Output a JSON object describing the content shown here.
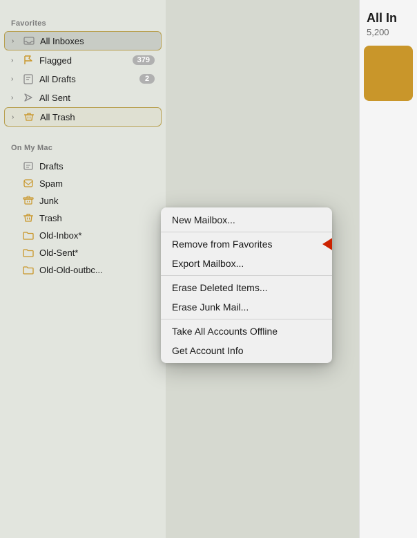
{
  "sidebar": {
    "favorites_label": "Favorites",
    "on_my_mac_label": "On My Mac",
    "items": [
      {
        "id": "all-inboxes",
        "label": "All Inboxes",
        "icon": "inbox",
        "badge": null,
        "active": true,
        "chevron": true
      },
      {
        "id": "flagged",
        "label": "Flagged",
        "icon": "flag",
        "badge": "379",
        "chevron": true
      },
      {
        "id": "all-drafts",
        "label": "All Drafts",
        "icon": "draft",
        "badge": "2",
        "chevron": true
      },
      {
        "id": "all-sent",
        "label": "All Sent",
        "icon": "sent",
        "badge": null,
        "chevron": true
      },
      {
        "id": "all-trash",
        "label": "All Trash",
        "icon": "trash",
        "badge": null,
        "active_border": true,
        "chevron": true
      }
    ],
    "on_my_mac_items": [
      {
        "id": "drafts",
        "label": "Drafts",
        "icon": "draft-folder",
        "color": "#888"
      },
      {
        "id": "spam",
        "label": "Spam",
        "icon": "spam-folder",
        "color": "#c9962a"
      },
      {
        "id": "junk",
        "label": "Junk",
        "icon": "junk-folder",
        "color": "#c9962a"
      },
      {
        "id": "trash",
        "label": "Trash",
        "icon": "trash-folder",
        "color": "#c9962a"
      },
      {
        "id": "old-inbox",
        "label": "Old-Inbox*",
        "icon": "folder",
        "color": "#c9962a"
      },
      {
        "id": "old-sent",
        "label": "Old-Sent*",
        "icon": "folder",
        "color": "#c9962a"
      },
      {
        "id": "old-old-outbc",
        "label": "Old-Old-outbc...",
        "icon": "folder",
        "color": "#c9962a"
      }
    ]
  },
  "context_menu": {
    "items": [
      {
        "id": "new-mailbox",
        "label": "New Mailbox...",
        "separator_after": true
      },
      {
        "id": "remove-from-favorites",
        "label": "Remove from Favorites",
        "has_arrow": true
      },
      {
        "id": "export-mailbox",
        "label": "Export Mailbox...",
        "separator_after": true
      },
      {
        "id": "erase-deleted",
        "label": "Erase Deleted Items...",
        "separator_after": false
      },
      {
        "id": "erase-junk",
        "label": "Erase Junk Mail...",
        "separator_after": true
      },
      {
        "id": "take-all-offline",
        "label": "Take All Accounts Offline",
        "separator_after": false
      },
      {
        "id": "get-account-info",
        "label": "Get Account Info",
        "separator_after": false
      }
    ]
  },
  "right_panel": {
    "title": "All In",
    "count": "5,200"
  }
}
